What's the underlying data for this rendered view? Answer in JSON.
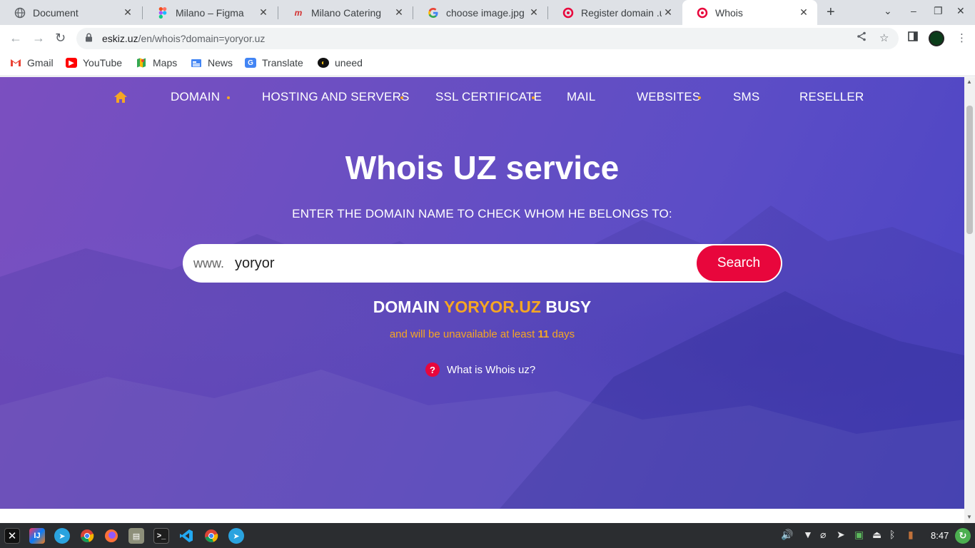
{
  "browser": {
    "tabs": [
      {
        "title": "Document",
        "icon": "globe-icon",
        "active": false
      },
      {
        "title": "Milano – Figma",
        "icon": "figma-icon",
        "active": false
      },
      {
        "title": "Milano Catering",
        "icon": "milano-icon",
        "active": false
      },
      {
        "title": "choose image.jpg",
        "icon": "google-icon",
        "active": false
      },
      {
        "title": "Register domain .uz",
        "icon": "eskiz-icon",
        "active": false
      },
      {
        "title": "Whois",
        "icon": "eskiz-icon",
        "active": true
      }
    ],
    "url_host": "eskiz.uz",
    "url_path": "/en/whois?domain=yoryor.uz",
    "bookmarks": [
      {
        "label": "Gmail",
        "icon": "gmail-icon"
      },
      {
        "label": "YouTube",
        "icon": "youtube-icon"
      },
      {
        "label": "Maps",
        "icon": "maps-icon"
      },
      {
        "label": "News",
        "icon": "news-icon"
      },
      {
        "label": "Translate",
        "icon": "translate-icon"
      },
      {
        "label": "uneed",
        "icon": "uneed-icon"
      }
    ]
  },
  "site": {
    "nav": [
      {
        "label": "DOMAIN",
        "has_dot": true
      },
      {
        "label": "HOSTING AND SERVERS",
        "has_dot": true
      },
      {
        "label": "SSL CERTIFICATE",
        "has_dot": true
      },
      {
        "label": "MAIL",
        "has_dot": false
      },
      {
        "label": "WEBSITES",
        "has_dot": true
      },
      {
        "label": "SMS",
        "has_dot": false
      },
      {
        "label": "RESELLER",
        "has_dot": false
      }
    ],
    "title": "Whois UZ service",
    "subtitle": "ENTER THE DOMAIN NAME TO CHECK WHOM HE BELONGS TO:",
    "search": {
      "prefix": "www.",
      "value": "yoryor",
      "button": "Search"
    },
    "result": {
      "before": "DOMAIN",
      "domain": "YORYOR.UZ",
      "after": "BUSY"
    },
    "availability": {
      "before": "and will be unavailable at least",
      "days": "11",
      "after": "days"
    },
    "help_link": "What is Whois uz?",
    "colors": {
      "accent": "#e8063c",
      "highlight": "#f5a623",
      "bg_start": "#7b4fc0",
      "bg_end": "#4a44c4"
    }
  },
  "taskbar": {
    "apps": [
      "x-icon",
      "intellij-icon",
      "telegram-icon",
      "chrome-icon",
      "firefox-icon",
      "files-icon",
      "terminal-icon",
      "vscode-icon",
      "chrome-icon",
      "telegram-icon"
    ],
    "clock": "8:47"
  }
}
